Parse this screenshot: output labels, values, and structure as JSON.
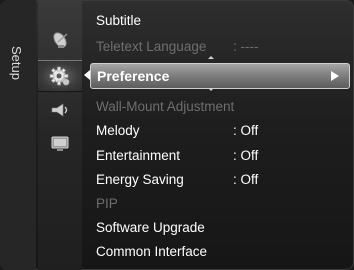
{
  "sidebar": {
    "tab_label": "Setup"
  },
  "icons": [
    {
      "name": "satellite-dish-icon",
      "active": false
    },
    {
      "name": "gear-icon",
      "active": true
    },
    {
      "name": "speaker-icon",
      "active": false
    },
    {
      "name": "input-source-icon",
      "active": false
    }
  ],
  "menu": {
    "items": [
      {
        "label": "Subtitle",
        "value": "",
        "state": "normal"
      },
      {
        "label": "Teletext Language",
        "value": ": ----",
        "state": "disabled"
      },
      {
        "label": "Preference",
        "value": "",
        "state": "highlighted"
      },
      {
        "label": "Wall-Mount Adjustment",
        "value": "",
        "state": "disabled"
      },
      {
        "label": "Melody",
        "value": ": Off",
        "state": "normal"
      },
      {
        "label": "Entertainment",
        "value": ": Off",
        "state": "normal"
      },
      {
        "label": "Energy Saving",
        "value": ": Off",
        "state": "normal"
      },
      {
        "label": "PIP",
        "value": "",
        "state": "disabled"
      },
      {
        "label": "Software Upgrade",
        "value": "",
        "state": "normal"
      },
      {
        "label": "Common Interface",
        "value": "",
        "state": "normal"
      }
    ]
  },
  "colors": {
    "text": "#ffffff",
    "disabled_text": "#6e6e6e",
    "highlight": "#8a8a8a",
    "background": "#1e1e1e"
  }
}
